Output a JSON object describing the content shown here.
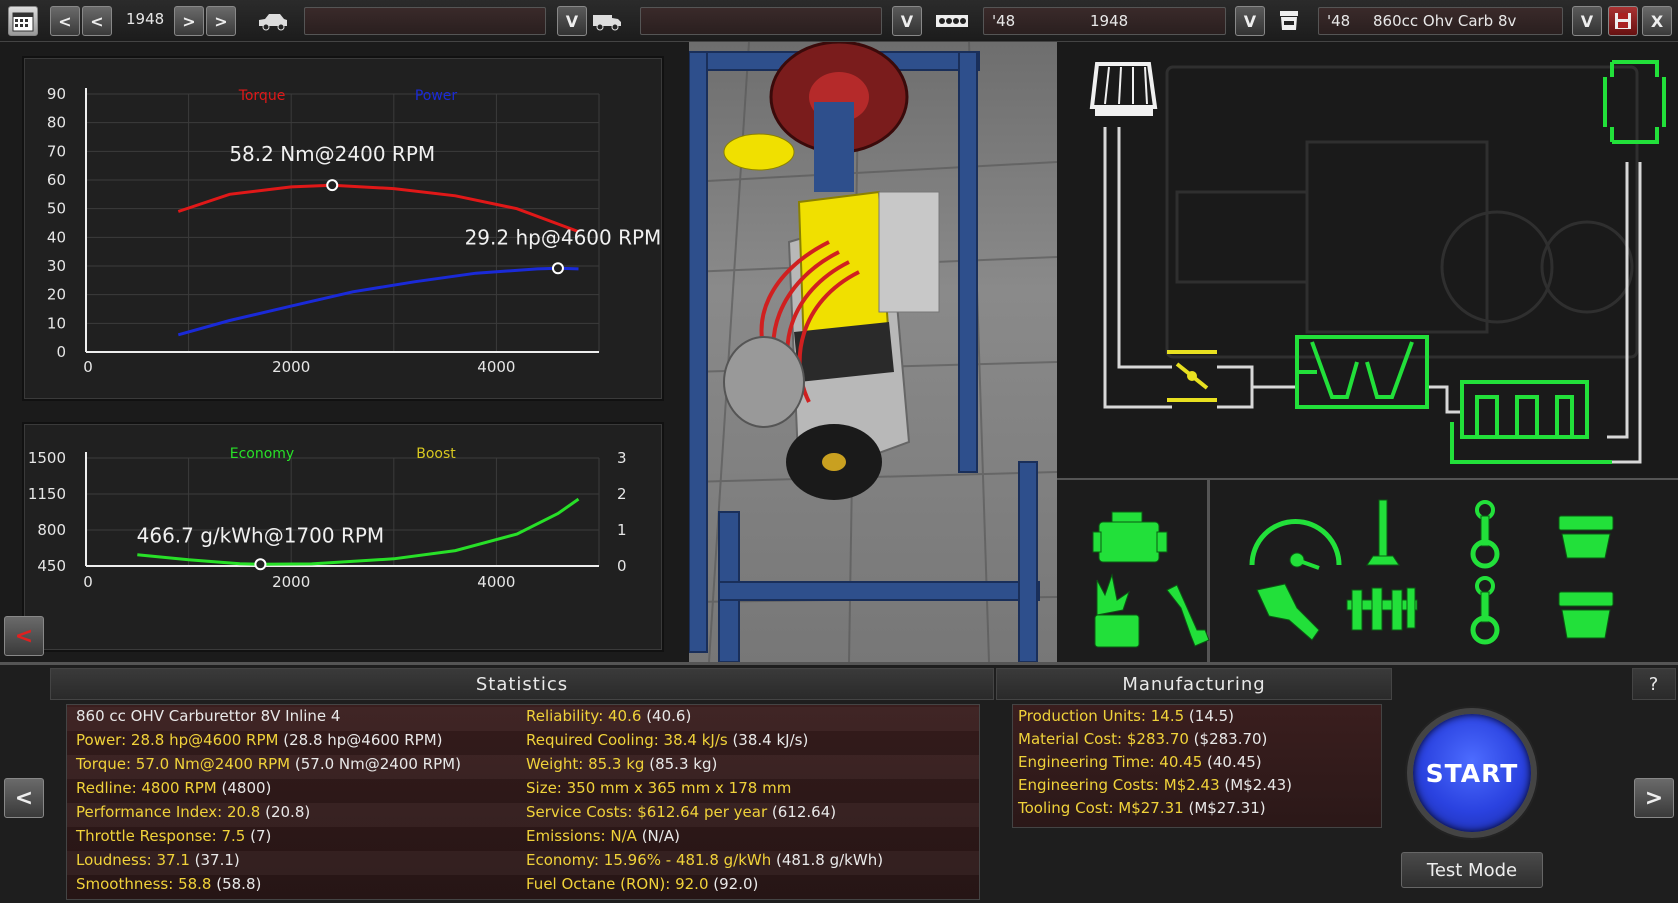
{
  "topbar": {
    "year": "1948",
    "family_year": "'48",
    "family_value": "1948",
    "variant_year": "'48",
    "variant_name": "860cc Ohv Carb 8v",
    "model_field": "",
    "trim_field": "",
    "dropdown_glyph": "V",
    "prev_glyph": "<",
    "next_glyph": ">",
    "close_glyph": "X"
  },
  "chart_data": [
    {
      "type": "line",
      "x_ticks": [
        "0",
        "2000",
        "4000"
      ],
      "y_ticks": [
        "0",
        "10",
        "20",
        "30",
        "40",
        "50",
        "60",
        "70",
        "80",
        "90"
      ],
      "xlim": [
        0,
        5000
      ],
      "ylim": [
        0,
        90
      ],
      "legend_placement": "top-center",
      "series": [
        {
          "name": "Torque",
          "color": "#e01818",
          "x": [
            900,
            1400,
            2000,
            2400,
            3000,
            3600,
            4200,
            4800
          ],
          "y": [
            49,
            55,
            57.6,
            58.2,
            57,
            54.5,
            50,
            42
          ]
        },
        {
          "name": "Power",
          "color": "#1a2ad8",
          "x": [
            900,
            1400,
            2000,
            2600,
            3200,
            3800,
            4400,
            4600,
            4800
          ],
          "y": [
            6,
            11,
            16,
            21,
            24.5,
            27.5,
            29,
            29.2,
            29
          ]
        }
      ],
      "annotations": [
        "58.2 Nm@2400 RPM",
        "29.2 hp@4600 RPM"
      ]
    },
    {
      "type": "line",
      "x_ticks": [
        "0",
        "2000",
        "4000"
      ],
      "y_ticks": [
        "450",
        "800",
        "1150",
        "1500"
      ],
      "y2_ticks": [
        "0",
        "1",
        "2",
        "3"
      ],
      "xlim": [
        0,
        5000
      ],
      "ylim": [
        450,
        1500
      ],
      "legend_placement": "top-center",
      "series": [
        {
          "name": "Economy",
          "color": "#28e028",
          "x": [
            500,
            1000,
            1500,
            1700,
            2200,
            3000,
            3600,
            4200,
            4600,
            4800
          ],
          "y": [
            560,
            510,
            472,
            466.7,
            470,
            520,
            600,
            760,
            960,
            1100
          ]
        },
        {
          "name": "Boost",
          "color": "#d8c820",
          "x": [],
          "y": []
        }
      ],
      "annotations": [
        "466.7 g/kWh@1700 RPM"
      ]
    }
  ],
  "statistics": {
    "title": "Statistics",
    "left": [
      {
        "y": "860 cc OHV Carburettor 8V Inline 4",
        "w": "",
        "all_white": true
      },
      {
        "y": "Power: 28.8 hp@4600 RPM",
        "w": " (28.8 hp@4600 RPM)"
      },
      {
        "y": "Torque: 57.0 Nm@2400 RPM",
        "w": " (57.0 Nm@2400 RPM)"
      },
      {
        "y": "Redline: 4800 RPM",
        "w": " (4800)"
      },
      {
        "y": "Performance Index: 20.8",
        "w": " (20.8)"
      },
      {
        "y": "Throttle Response: 7.5",
        "w": " (7)"
      },
      {
        "y": "Loudness: 37.1",
        "w": " (37.1)"
      },
      {
        "y": "Smoothness: 58.8",
        "w": " (58.8)"
      }
    ],
    "right": [
      {
        "y": "Reliability: 40.6",
        "w": " (40.6)"
      },
      {
        "y": "Required Cooling: 38.4 kJ/s",
        "w": " (38.4 kJ/s)"
      },
      {
        "y": "Weight: 85.3 kg",
        "w": " (85.3 kg)"
      },
      {
        "y": "Size: 350 mm x 365 mm x 178 mm",
        "w": ""
      },
      {
        "y": "Service Costs: $612.64 per year",
        "w": " (612.64)"
      },
      {
        "y": "Emissions: N/A",
        "w": " (N/A)"
      },
      {
        "y": "Economy: 15.96% - 481.8 g/kWh",
        "w": " (481.8 g/kWh)"
      },
      {
        "y": "Fuel Octane (RON): 92.0",
        "w": " (92.0)"
      }
    ]
  },
  "manufacturing": {
    "title": "Manufacturing",
    "lines": [
      {
        "y": "Production Units: 14.5",
        "w": " (14.5)"
      },
      {
        "y": "Material Cost: $283.70",
        "w": " ($283.70)"
      },
      {
        "y": "Engineering Time: 40.45",
        "w": " (40.45)"
      },
      {
        "y": "Engineering Costs: M$2.43",
        "w": " (M$2.43)"
      },
      {
        "y": "Tooling Cost: M$27.31",
        "w": " (M$27.31)"
      }
    ]
  },
  "actions": {
    "start": "START",
    "test_mode": "Test Mode",
    "help": "?",
    "back": "<",
    "forward": ">"
  },
  "colors": {
    "accent_green": "#22e03a",
    "stat_yellow": "#f0d23a",
    "start_blue": "#2a42e0"
  }
}
